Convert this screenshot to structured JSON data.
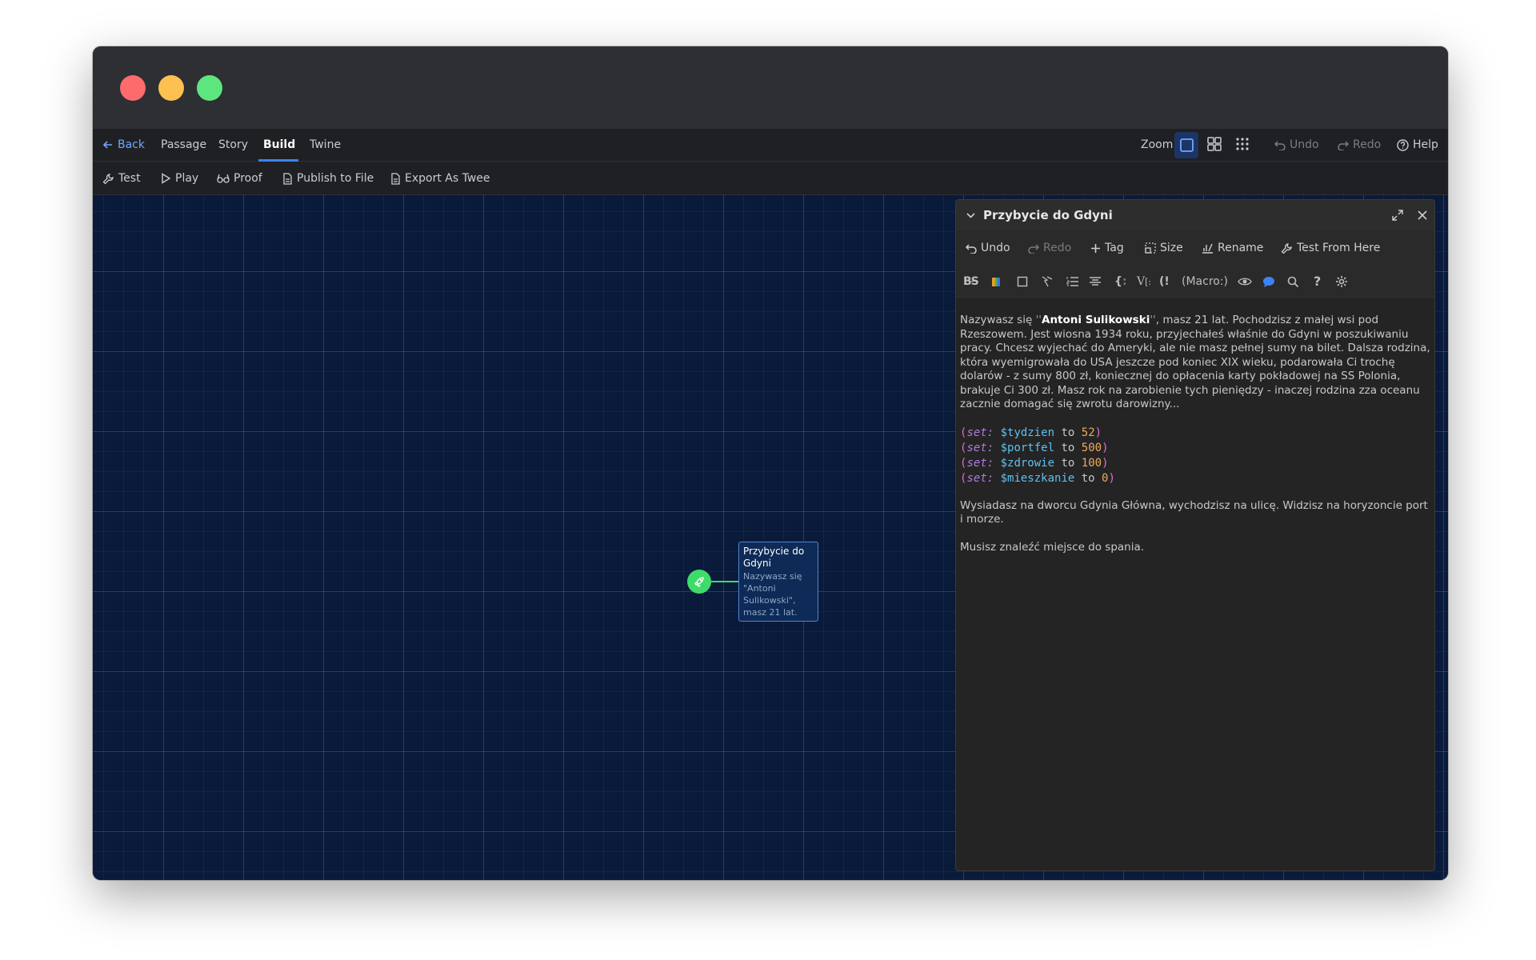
{
  "menubar": {
    "back": "Back",
    "tabs": [
      "Passage",
      "Story",
      "Build",
      "Twine"
    ],
    "zoom_label": "Zoom",
    "undo": "Undo",
    "redo": "Redo",
    "help": "Help"
  },
  "toolbar": {
    "test": "Test",
    "play": "Play",
    "proof": "Proof",
    "publish": "Publish to File",
    "export": "Export As Twee"
  },
  "passage": {
    "title": "Przybycie do Gdyni",
    "excerpt": "Nazywasz się \"Antoni Sulikowski\", masz 21 lat."
  },
  "dialog": {
    "title": "Przybycie do Gdyni",
    "actions": {
      "undo": "Undo",
      "redo": "Redo",
      "tag": "Tag",
      "size": "Size",
      "rename": "Rename",
      "test_from_here": "Test From Here"
    },
    "format": {
      "macro": "(Macro:)"
    },
    "text": {
      "p1_a": "Nazywasz się ",
      "p1_quote_open": "''",
      "p1_name": "Antoni Sulikowski",
      "p1_quote_close": "''",
      "p1_b": ", masz 21 lat. Pochodzisz z małej wsi pod Rzeszowem. Jest wiosna 1934 roku, przyjechałeś właśnie do Gdyni w poszukiwaniu pracy. Chcesz wyjechać do Ameryki, ale nie masz pełnej sumy na bilet. Dalsza rodzina, która wyemigrowała do USA jeszcze pod koniec XIX wieku, podarowała Ci trochę dolarów - z sumy 800 zł, koniecznej do opłacenia karty pokładowej na SS Polonia, brakuje Ci 300 zł. Masz rok na zarobienie tych pieniędzy - inaczej rodzina zza oceanu zacznie domagać się zwrotu darowizny...",
      "code": [
        {
          "macro": "set:",
          "var": "$tydzien",
          "to": "to",
          "val": "52"
        },
        {
          "macro": "set:",
          "var": "$portfel",
          "to": "to",
          "val": "500"
        },
        {
          "macro": "set:",
          "var": "$zdrowie",
          "to": "to",
          "val": "100"
        },
        {
          "macro": "set:",
          "var": "$mieszkanie",
          "to": "to",
          "val": "0"
        }
      ],
      "p2": "Wysiadasz na dworcu Gdynia Główna, wychodzisz na ulicę. Widzisz na horyzoncie port i morze.",
      "p3": "Musisz znaleźć miejsce do spania."
    }
  }
}
